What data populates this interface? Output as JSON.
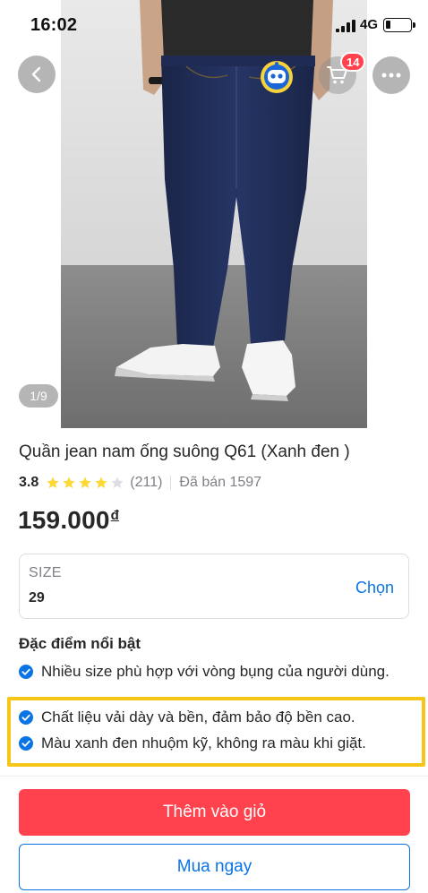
{
  "status_bar": {
    "time": "16:02",
    "network": "4G"
  },
  "header": {
    "cart_count": "14",
    "image_counter": "1/9"
  },
  "product": {
    "title": "Quần jean nam ống suông Q61 (Xanh đen )",
    "rating": "3.8",
    "stars_filled": 4,
    "stars_total": 5,
    "review_count": "(211)",
    "sold": "Đã bán 1597",
    "price": "159.000",
    "currency": "đ"
  },
  "size_selector": {
    "label": "SIZE",
    "value": "29",
    "choose": "Chọn"
  },
  "features": {
    "title": "Đặc điểm nổi bật",
    "items": [
      "Nhiều size phù hợp với vòng bụng của người dùng.",
      "Chất liệu vải dày và bền, đảm bảo độ bền cao.",
      "Màu xanh đen nhuộm kỹ, không ra màu khi giặt."
    ]
  },
  "actions": {
    "add_to_cart": "Thêm vào giỏ",
    "buy_now": "Mua ngay"
  },
  "colors": {
    "primary_red": "#ff424e",
    "link_blue": "#0b74e5",
    "highlight": "#f5c518",
    "star": "#fdd836"
  },
  "icons": [
    "back-arrow-icon",
    "chatbot-icon",
    "cart-icon",
    "more-icon",
    "star-icon",
    "check-circle-icon"
  ]
}
